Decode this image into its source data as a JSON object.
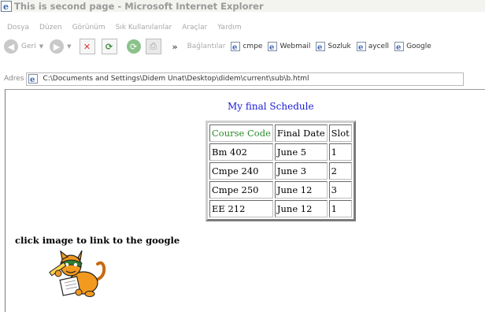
{
  "window": {
    "title": "This is second page - Microsoft Internet Explorer"
  },
  "menu": {
    "items": [
      "Dosya",
      "Düzen",
      "Görünüm",
      "Sık Kullanılanlar",
      "Araçlar",
      "Yardım"
    ]
  },
  "toolbar": {
    "back_label": "Geri",
    "more_glyph": "»",
    "links_label": "Bağlantılar",
    "links": [
      "cmpe",
      "Webmail",
      "Sozluk",
      "aycell",
      "Google"
    ]
  },
  "address": {
    "label": "Adres",
    "value": "C:\\Documents and Settings\\Didem Unat\\Desktop\\didem\\current\\sub\\b.html"
  },
  "page": {
    "heading": "My final Schedule",
    "table": {
      "headers": [
        "Course Code",
        "Final Date",
        "Slot"
      ],
      "rows": [
        [
          "Bm 402",
          "June 5",
          "1"
        ],
        [
          "Cmpe 240",
          "June 3",
          "2"
        ],
        [
          "Cmpe 250",
          "June 12",
          "3"
        ],
        [
          "EE 212",
          "June 12",
          "1"
        ]
      ]
    },
    "caption": "click image to link to the google"
  },
  "colors": {
    "heading": "#1a1ad8",
    "header_cell": "#2a8a2a"
  }
}
